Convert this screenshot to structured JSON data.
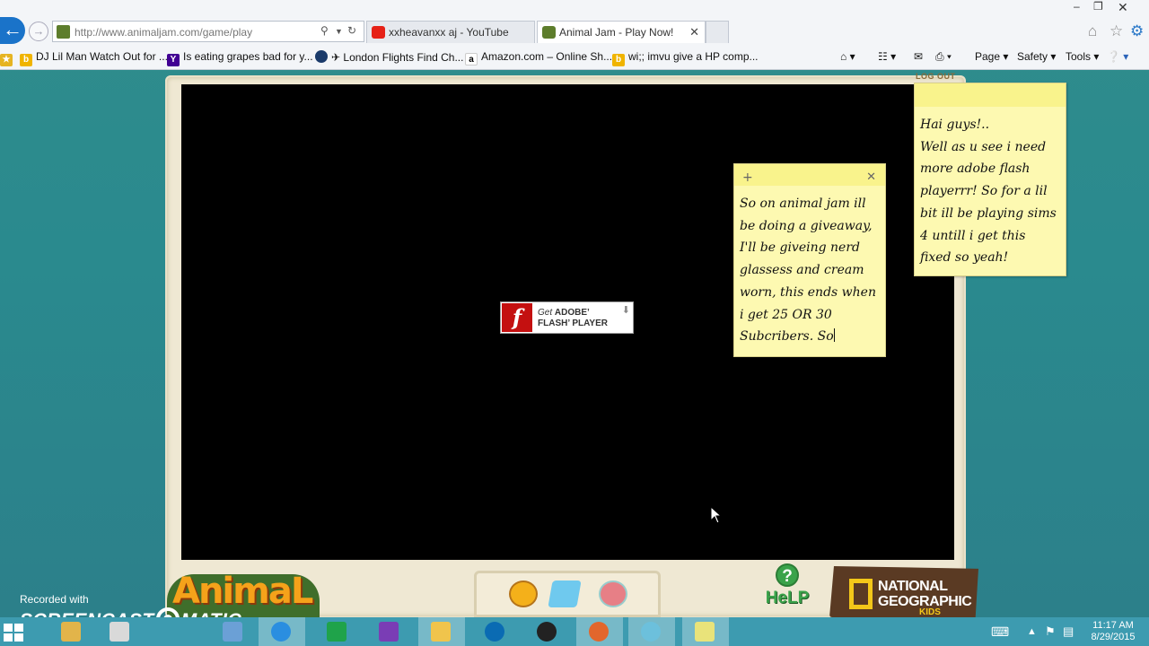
{
  "browser": {
    "address_url": "http://www.animaljam.com/game/play",
    "url_host_part": "www.animaljam.com",
    "tabs": [
      {
        "label": "xxheavanxx aj - YouTube",
        "active": false,
        "icon": "youtube-icon",
        "color": "#e62117"
      },
      {
        "label": "Animal Jam - Play Now!",
        "active": true,
        "icon": "animal-jam-icon",
        "color": "#5d7d2c"
      }
    ],
    "favorites": [
      {
        "label": "DJ Lil Man Watch Out for ...",
        "icon": "bing-icon"
      },
      {
        "label": "Is eating grapes bad for y...",
        "icon": "yahoo-icon"
      },
      {
        "label": "✈ London Flights Find Ch...",
        "icon": "globe-icon"
      },
      {
        "label": "Amazon.com – Online Sh...",
        "icon": "amazon-icon"
      },
      {
        "label": "wi;; imvu give a HP comp...",
        "icon": "bing-icon"
      }
    ],
    "commands": {
      "page": "Page",
      "safety": "Safety",
      "tools": "Tools"
    }
  },
  "game": {
    "flash_badge": {
      "get": "Get",
      "adobe": "ADOBE’",
      "flash_player": "FLASH’ PLAYER"
    },
    "logout": "LOG OUT",
    "logo_text": "AnimaL",
    "help": "HeLP",
    "natgeo": {
      "line1": "NATIONAL",
      "line2": "GEOGRAPHIC",
      "kids": "KIDS"
    }
  },
  "sticky_notes": [
    {
      "text": "So on animal jam ill\nbe doing a giveaway,\nI'll be giveing nerd\nglassess and cream\nworn, this ends when\ni get 25 OR 30\nSubcribers. So"
    },
    {
      "text": "Hai guys!..\nWell as u see i need\nmore adobe flash\nplayerrr! So for a lil\nbit ill be playing sims\n4 untill i get this\nfixed so yeah!"
    }
  ],
  "watermark": {
    "recorded_with": "Recorded with",
    "brand_left": "SCREENCAST",
    "brand_right": "MATIC"
  },
  "taskbar": {
    "time": "11:17 AM",
    "date": "8/29/2015",
    "apps": [
      {
        "icon": "file-explorer-icon",
        "color": "#e2b44a"
      },
      {
        "icon": "document-icon",
        "color": "#d9d9d9"
      },
      {
        "icon": "pc-icon",
        "color": "#6ba0d6"
      },
      {
        "icon": "internet-explorer-icon",
        "color": "#2a8ee0"
      },
      {
        "icon": "store-icon",
        "color": "#1fa34a"
      },
      {
        "icon": "photos-icon",
        "color": "#7a3db5"
      },
      {
        "icon": "folder-icon",
        "color": "#f0c44c"
      },
      {
        "icon": "hp-icon",
        "color": "#0a6bb3"
      },
      {
        "icon": "webcam-icon",
        "color": "#222222"
      },
      {
        "icon": "media-icon",
        "color": "#e2662c"
      },
      {
        "icon": "circle-app-icon",
        "color": "#6cc0dc"
      },
      {
        "icon": "sticky-notes-icon",
        "color": "#e9e37a"
      }
    ]
  }
}
